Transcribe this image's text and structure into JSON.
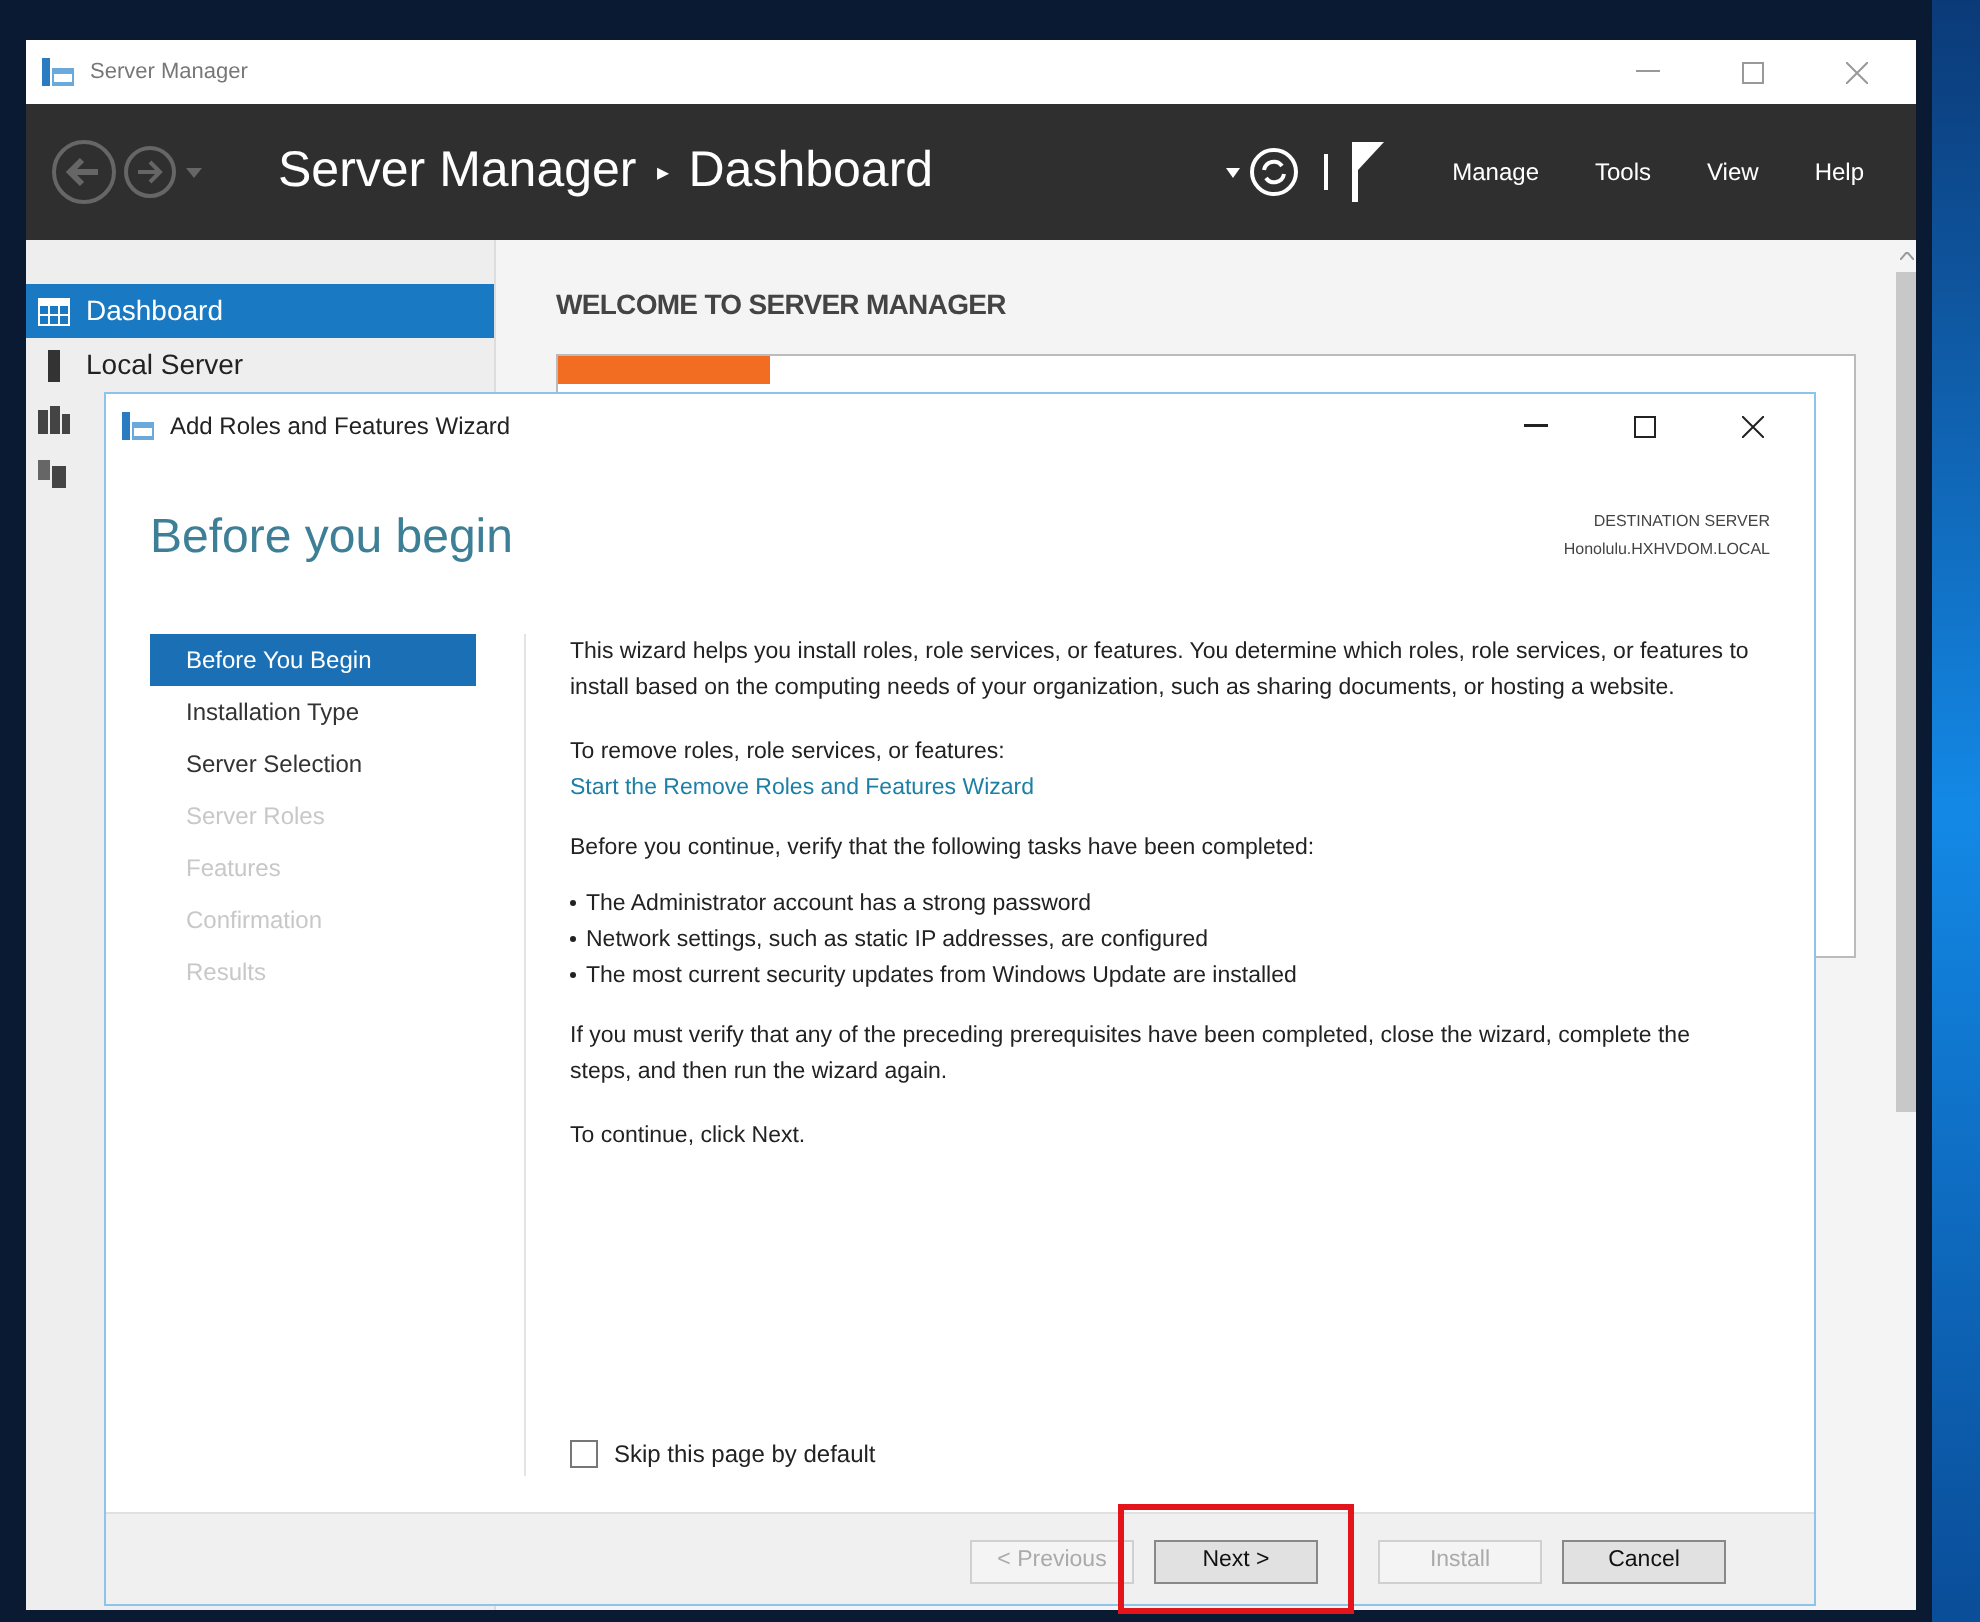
{
  "server_manager": {
    "title": "Server Manager",
    "breadcrumb": [
      "Server Manager",
      "Dashboard"
    ],
    "separator": "▸",
    "menus": [
      "Manage",
      "Tools",
      "View",
      "Help"
    ],
    "sidebar": [
      {
        "label": "Dashboard",
        "kind": "dashboard",
        "selected": true
      },
      {
        "label": "Local Server",
        "kind": "server",
        "selected": false
      },
      {
        "kind": "servers",
        "selected": false
      },
      {
        "kind": "roles",
        "selected": false
      }
    ],
    "welcome_heading": "WELCOME TO SERVER MANAGER"
  },
  "wizard": {
    "title": "Add Roles and Features Wizard",
    "heading": "Before you begin",
    "destination_label": "DESTINATION SERVER",
    "destination_server": "Honolulu.HXHVDOM.LOCAL",
    "steps": [
      {
        "label": "Before You Begin",
        "selected": true,
        "disabled": false
      },
      {
        "label": "Installation Type",
        "selected": false,
        "disabled": false
      },
      {
        "label": "Server Selection",
        "selected": false,
        "disabled": false
      },
      {
        "label": "Server Roles",
        "selected": false,
        "disabled": true
      },
      {
        "label": "Features",
        "selected": false,
        "disabled": true
      },
      {
        "label": "Confirmation",
        "selected": false,
        "disabled": true
      },
      {
        "label": "Results",
        "selected": false,
        "disabled": true
      }
    ],
    "intro": "This wizard helps you install roles, role services, or features. You determine which roles, role services, or features to install based on the computing needs of your organization, such as sharing documents, or hosting a website.",
    "remove_label": "To remove roles, role services, or features:",
    "remove_link": "Start the Remove Roles and Features Wizard",
    "verify_text": "Before you continue, verify that the following tasks have been completed:",
    "tasks": [
      "The Administrator account has a strong password",
      "Network settings, such as static IP addresses, are configured",
      "The most current security updates from Windows Update are installed"
    ],
    "prereq_text": "If you must verify that any of the preceding prerequisites have been completed, close the wizard, complete the steps, and then run the wizard again.",
    "continue_text": "To continue, click Next.",
    "skip": {
      "label": "Skip this page by default",
      "checked": false
    },
    "buttons": [
      {
        "label": "< Previous",
        "disabled": true,
        "highlighted": false
      },
      {
        "label": "Next >",
        "disabled": false,
        "highlighted": true
      },
      {
        "label": "Install",
        "disabled": true,
        "highlighted": false
      },
      {
        "label": "Cancel",
        "disabled": false,
        "highlighted": false
      }
    ]
  }
}
